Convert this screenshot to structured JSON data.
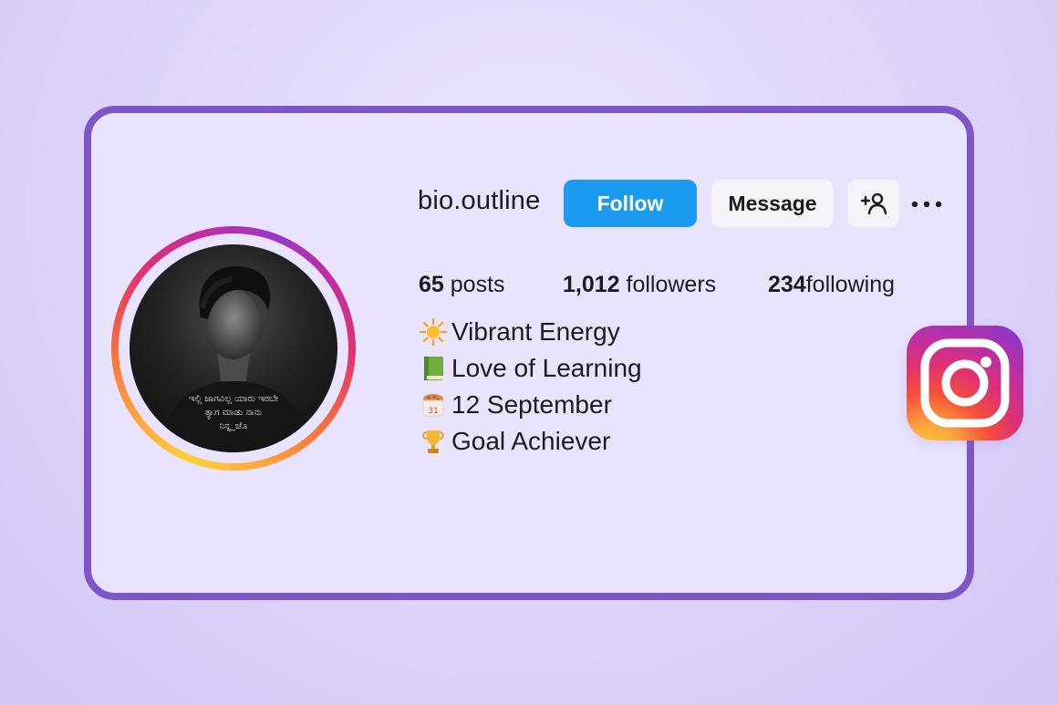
{
  "profile": {
    "username": "bio.outline",
    "avatar_caption": [
      "ಇಲ್ಲಿ ಜಾಗವಿಲ್ಲ ಯಾರು ಇರಬೇ",
      "ತ್ಯಾಗ ಮಾಡು ನಾನು",
      "ನಿನ್ನ_ಜೊ"
    ]
  },
  "actions": {
    "follow_label": "Follow",
    "message_label": "Message",
    "add_user_icon": "add-user-icon",
    "more_icon": "more-options-icon"
  },
  "stats": {
    "posts_count": "65",
    "posts_label": "posts",
    "followers_count": "1,012",
    "followers_label": "followers",
    "following_count": "234",
    "following_label": "following"
  },
  "bio": [
    {
      "icon": "sun-icon",
      "text": "Vibrant Energy"
    },
    {
      "icon": "green-book-icon",
      "text": "Love of Learning"
    },
    {
      "icon": "birthday-cake-icon",
      "text": "12 September"
    },
    {
      "icon": "trophy-icon",
      "text": "Goal Achiever"
    }
  ],
  "colors": {
    "follow_button": "#1a9bf0",
    "card_border": "#7d56c8",
    "card_background": "#e9e3fd"
  },
  "brand": {
    "logo": "instagram-logo"
  }
}
